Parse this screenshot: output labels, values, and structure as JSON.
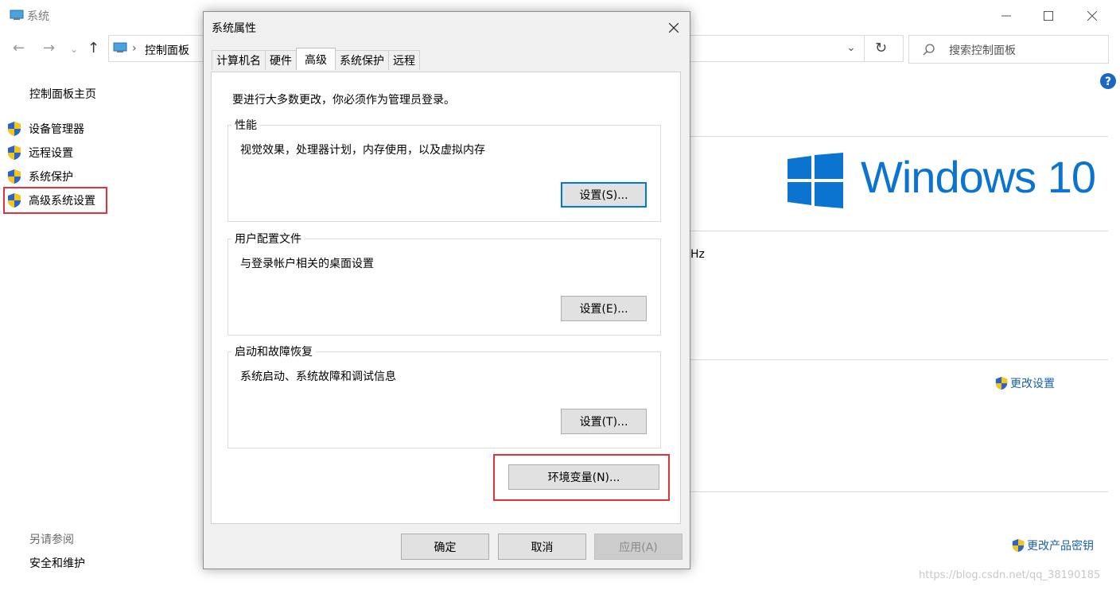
{
  "background": {
    "window_title": "系统",
    "breadcrumb": "控制面板",
    "search_placeholder": "搜索控制面板",
    "sidebar": {
      "home": "控制面板主页",
      "items": [
        {
          "label": "设备管理器",
          "icon": "shield-icon"
        },
        {
          "label": "远程设置",
          "icon": "shield-icon"
        },
        {
          "label": "系统保护",
          "icon": "shield-icon"
        },
        {
          "label": "高级系统设置",
          "icon": "shield-icon"
        }
      ],
      "see_also": "另请参阅",
      "security": "安全和维护"
    },
    "windows_logo_text": "Windows 10",
    "partial_text_hz": "Hz",
    "change_settings": "更改设置",
    "change_product_key": "更改产品密钥",
    "watermark": "https://blog.csdn.net/qq_38190185"
  },
  "dialog": {
    "title": "系统属性",
    "tabs": [
      "计算机名",
      "硬件",
      "高级",
      "系统保护",
      "远程"
    ],
    "active_tab": "高级",
    "intro": "要进行大多数更改，你必须作为管理员登录。",
    "performance": {
      "label": "性能",
      "desc": "视觉效果，处理器计划，内存使用，以及虚拟内存",
      "button": "设置(S)..."
    },
    "profiles": {
      "label": "用户配置文件",
      "desc": "与登录帐户相关的桌面设置",
      "button": "设置(E)..."
    },
    "startup": {
      "label": "启动和故障恢复",
      "desc": "系统启动、系统故障和调试信息",
      "button": "设置(T)..."
    },
    "env_button": "环境变量(N)...",
    "ok": "确定",
    "cancel": "取消",
    "apply": "应用(A)"
  },
  "colors": {
    "accent": "#0078d7",
    "highlight_box": "#e0343b",
    "logo_blue": "#0a74d0",
    "link": "#1b5fad"
  }
}
